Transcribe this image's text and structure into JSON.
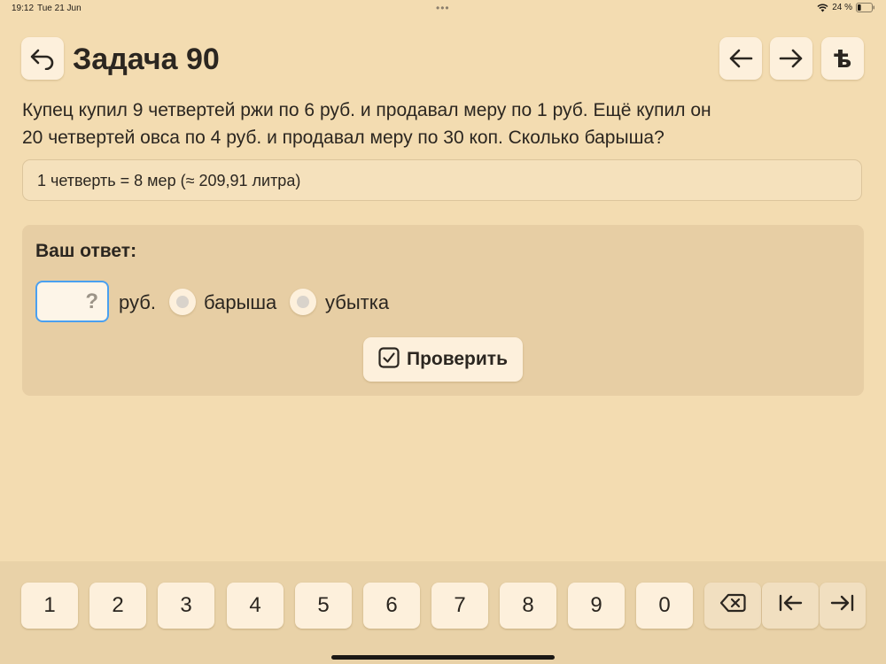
{
  "status_bar": {
    "time": "19:12",
    "date": "Tue 21 Jun",
    "dots": "•••",
    "battery_percent": "24 %",
    "battery_level": 0.24
  },
  "header": {
    "title": "Задача 90",
    "back_icon": "undo-arrow-icon",
    "prev_icon": "arrow-left-icon",
    "next_icon": "arrow-right-icon",
    "yat_glyph": "ѣ"
  },
  "problem": {
    "line1": "Купец купил 9 четвертей ржи по 6 руб. и продавал меру по 1 руб. Ещё купил он",
    "line2": "20 четвертей овса по 4 руб. и продавал меру по 30 коп. Сколько барыша?",
    "hint": "1 четверть = 8 мер (≈ 209,91 литра)"
  },
  "answer": {
    "label": "Ваш ответ:",
    "input_value": "",
    "input_placeholder": "?",
    "unit": "руб.",
    "options": [
      {
        "label": "барыша",
        "selected": false
      },
      {
        "label": "убытка",
        "selected": false
      }
    ],
    "check_label": "Проверить"
  },
  "keypad": {
    "digits": [
      "1",
      "2",
      "3",
      "4",
      "5",
      "6",
      "7",
      "8",
      "9",
      "0"
    ],
    "function_keys": [
      "backspace-icon",
      "tab-left-icon",
      "tab-right-icon"
    ]
  },
  "colors": {
    "background": "#f3dcb1",
    "panel": "#e7cea4",
    "button": "#fdf0dc",
    "input_border": "#4aa0f0",
    "text": "#2b2620"
  }
}
